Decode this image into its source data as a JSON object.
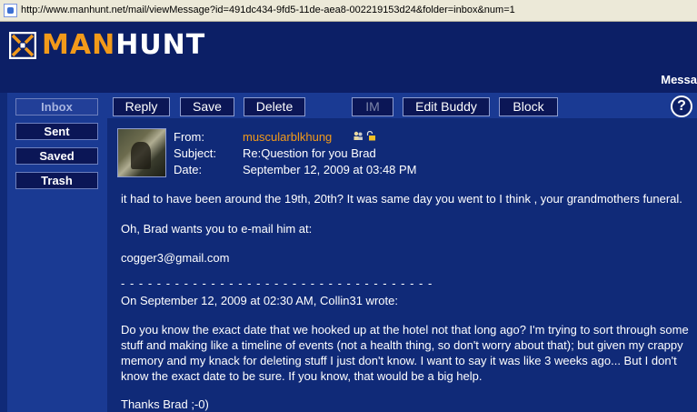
{
  "browser": {
    "url": "http://www.manhunt.net/mail/viewMessage?id=491dc434-9fd5-11de-aea8-002219153d24&folder=inbox&num=1"
  },
  "header": {
    "logo_part1": "MAN",
    "logo_part2": "HUNT",
    "tab_label": "Messa"
  },
  "sidebar": {
    "items": [
      {
        "label": "Inbox"
      },
      {
        "label": "Sent"
      },
      {
        "label": "Saved"
      },
      {
        "label": "Trash"
      }
    ]
  },
  "toolbar": {
    "reply": "Reply",
    "save": "Save",
    "delete": "Delete",
    "im": "IM",
    "edit_buddy": "Edit Buddy",
    "block": "Block",
    "help": "?"
  },
  "message": {
    "from_label": "From:",
    "subject_label": "Subject:",
    "date_label": "Date:",
    "from": "muscularblkhung",
    "subject": "Re:Question for you Brad",
    "date": "September 12, 2009 at 03:48 PM",
    "body": {
      "line1": "it had to have been around the 19th, 20th? It was same day you went to I think , your grandmothers funeral.",
      "line2": "Oh, Brad wants you to e-mail him at:",
      "line3": "cogger3@gmail.com",
      "divider": "- - - - - - - - - - - - - - - - - - - - - - - - - - - - - - - - - - -",
      "quote_header": "On September 12, 2009 at 02:30 AM, Collin31 wrote:",
      "quote_body": "Do you know the exact date that we hooked up at the hotel not that long ago? I'm trying to sort through some stuff and making like a timeline of events (not a health thing, so don't worry about that); but given my crappy memory and my knack for deleting stuff I just don't know. I want to say it was like 3 weeks ago... But I don't know the exact date to be sure. If you know, that would be a big help.",
      "signoff": "Thanks Brad ;-0)"
    }
  },
  "colors": {
    "accent": "#f29a1a",
    "background": "#102a78",
    "panel": "#1a3a93",
    "button": "#0b1656"
  }
}
